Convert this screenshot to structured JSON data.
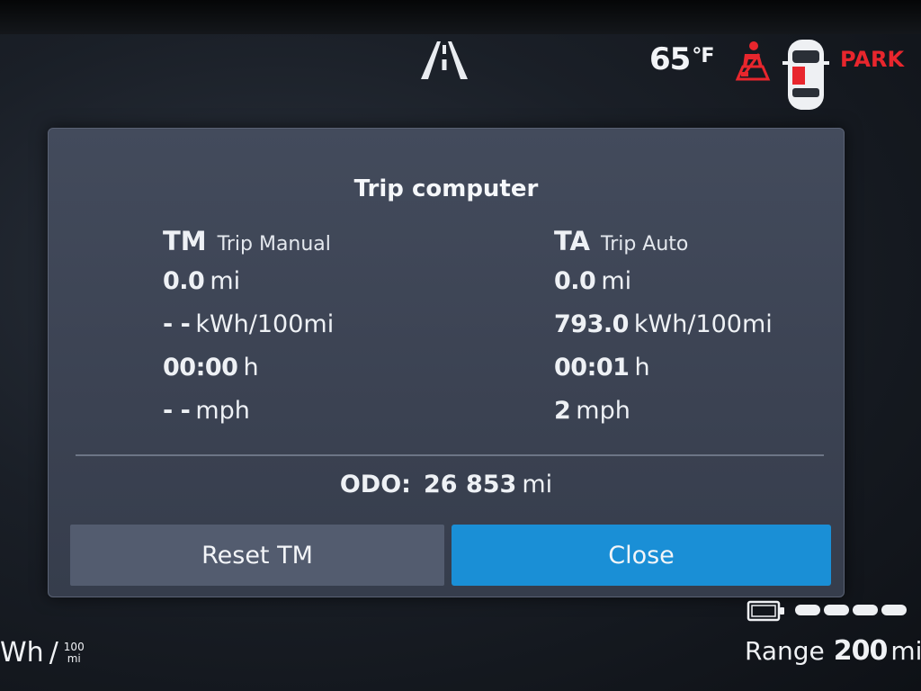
{
  "status_bar": {
    "temperature": "65",
    "temperature_unit": "°F",
    "gear": "PARK",
    "icons": [
      "road-lane-icon",
      "seatbelt-warning-icon",
      "car-top-view-icon"
    ],
    "colors": {
      "warning": "#e8262d"
    }
  },
  "dialog": {
    "title": "Trip computer",
    "trip_manual": {
      "abbr": "TM",
      "label": "Trip Manual",
      "distance": {
        "value": "0.0",
        "unit": "mi"
      },
      "consumption": {
        "value": "- -",
        "unit": "kWh/100mi"
      },
      "time": {
        "value": "00:00",
        "unit": "h"
      },
      "speed": {
        "value": "- -",
        "unit": "mph"
      }
    },
    "trip_auto": {
      "abbr": "TA",
      "label": "Trip Auto",
      "distance": {
        "value": "0.0",
        "unit": "mi"
      },
      "consumption": {
        "value": "793.0",
        "unit": "kWh/100mi"
      },
      "time": {
        "value": "00:01",
        "unit": "h"
      },
      "speed": {
        "value": "2",
        "unit": "mph"
      }
    },
    "odometer": {
      "label": "ODO:",
      "value": "26 853",
      "unit": "mi"
    },
    "buttons": {
      "reset": "Reset TM",
      "close": "Close"
    },
    "colors": {
      "close_button": "#1a8fd6",
      "reset_button": "#535c6f"
    }
  },
  "bottom": {
    "consumption_unit_partial": "Wh",
    "consumption_fraction_top": "100",
    "consumption_fraction_bottom": "mi",
    "range_label": "Range",
    "range_value": "200",
    "range_unit": "mi",
    "icons": [
      "battery-icon"
    ],
    "battery_level": 1.0
  }
}
